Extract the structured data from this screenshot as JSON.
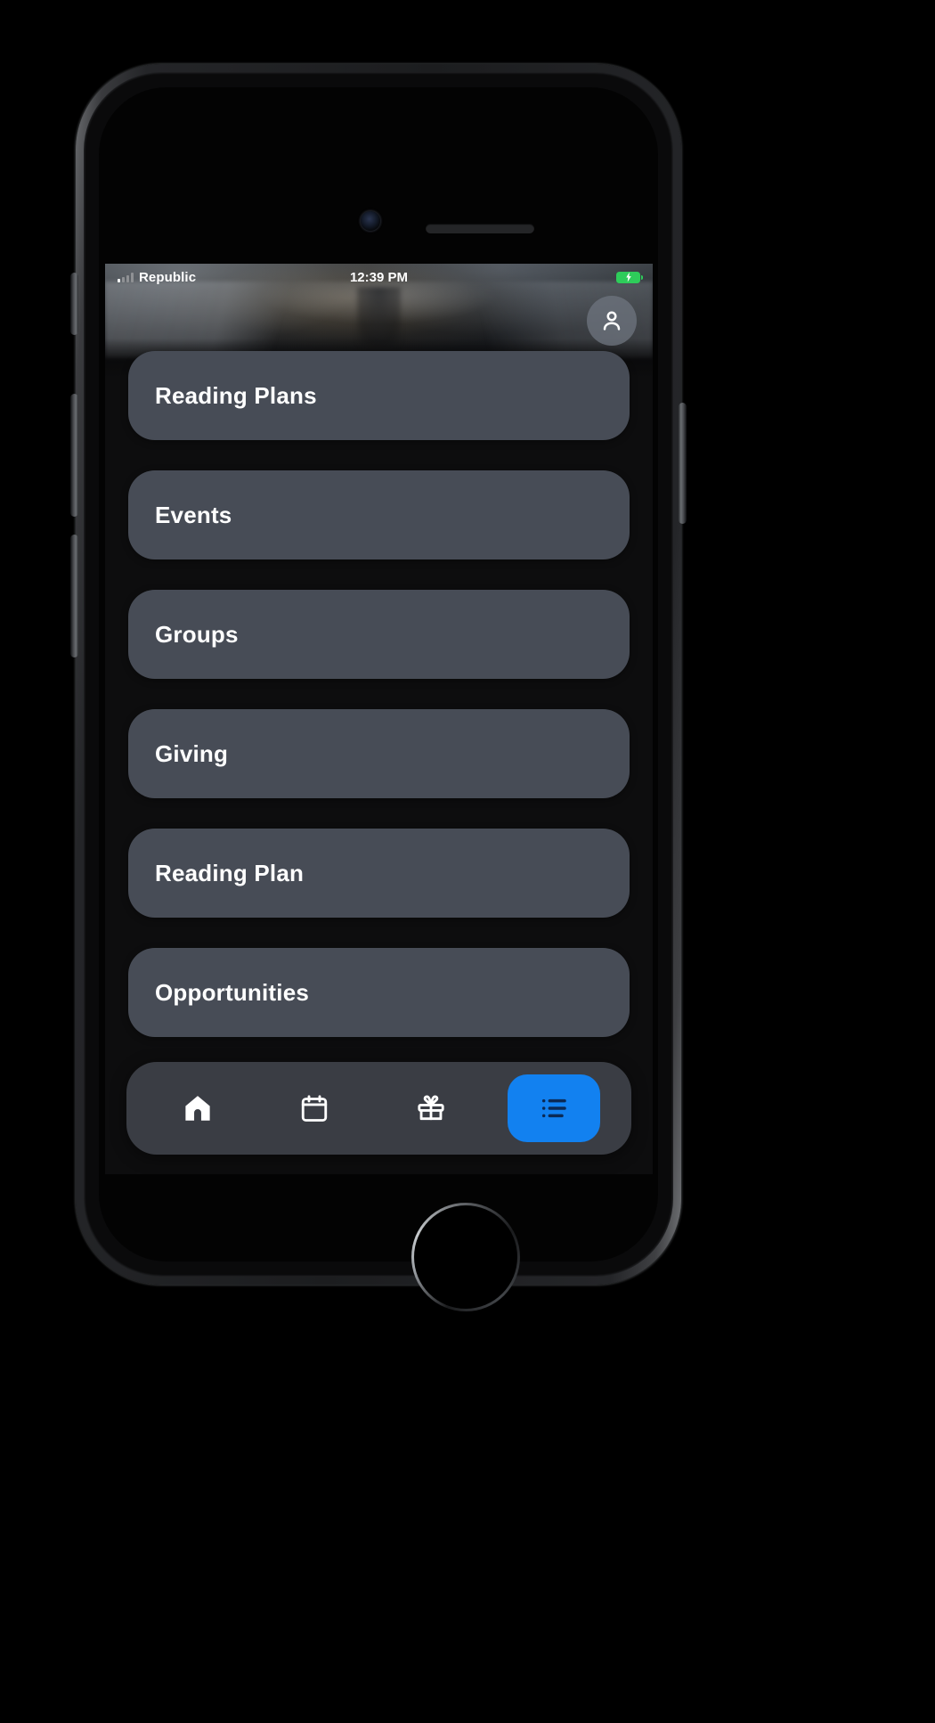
{
  "status_bar": {
    "carrier": "Republic",
    "time": "12:39 PM",
    "battery_icon": "battery-charging-icon",
    "signal_icon": "signal-bars-icon"
  },
  "header": {
    "background_image": "open-bible-photo",
    "avatar_icon": "person-icon"
  },
  "menu": {
    "items": [
      {
        "label": "Reading Plans"
      },
      {
        "label": "Events"
      },
      {
        "label": "Groups"
      },
      {
        "label": "Giving"
      },
      {
        "label": "Reading Plan"
      },
      {
        "label": "Opportunities"
      }
    ]
  },
  "tabbar": {
    "tabs": [
      {
        "name": "home",
        "icon": "home-icon",
        "active": false
      },
      {
        "name": "events",
        "icon": "calendar-icon",
        "active": false
      },
      {
        "name": "giving",
        "icon": "gift-icon",
        "active": false
      },
      {
        "name": "more",
        "icon": "list-icon",
        "active": true
      }
    ]
  },
  "colors": {
    "accent_blue": "#1281f0",
    "card_gray": "#474c56",
    "tabbar_gray": "#3a3d44",
    "screen_black": "#0d0d0e",
    "battery_green": "#2ecc5a"
  },
  "device": {
    "type": "smartphone-frame",
    "camera": "front-camera",
    "speaker": "earpiece-speaker",
    "home_button": "home-button"
  }
}
